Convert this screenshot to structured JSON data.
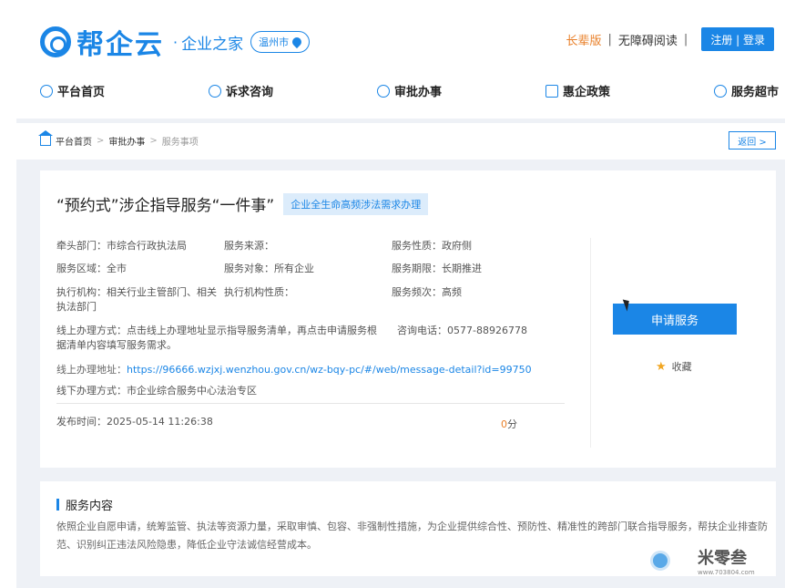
{
  "header": {
    "logo_text": "帮企云",
    "logo_sep": "·",
    "logo_sub": "企业之家",
    "city": "温州市",
    "elder_mode": "长辈版",
    "sep": "|",
    "accessibility": "无障碍阅读",
    "sep2": "|",
    "login": "注册 | 登录"
  },
  "nav": {
    "items": [
      {
        "label": "平台首页",
        "icon": "home-icon"
      },
      {
        "label": "诉求咨询",
        "icon": "chat-icon"
      },
      {
        "label": "审批办事",
        "icon": "person-icon"
      },
      {
        "label": "惠企政策",
        "icon": "document-icon"
      },
      {
        "label": "服务超市",
        "icon": "shop-icon"
      }
    ]
  },
  "breadcrumb": {
    "items": [
      "平台首页",
      "审批办事",
      "服务事项"
    ],
    "sep": ">",
    "back": "返回 >"
  },
  "detail": {
    "title": "“预约式”涉企指导服务“一件事”",
    "tag": "企业全生命高频涉法需求办理",
    "lead_dept": "牵头部门：市综合行政执法局",
    "service_source": "服务来源：",
    "service_nature": "服务性质：政府侧",
    "service_area": "服务区域：全市",
    "service_target": "服务对象：所有企业",
    "service_period": "服务期限：长期推进",
    "exec_agency": "执行机构：相关行业主管部门、相关执法部门",
    "exec_agency_nature": "执行机构性质：",
    "service_freq": "服务频次：高频",
    "online_method": "线上办理方式：点击线上办理地址显示指导服务清单，再点击申请服务根据清单内容填写服务需求。",
    "phone": "咨询电话：0577-88926778",
    "online_addr_label": "线上办理地址：",
    "online_addr_url": "https://96666.wzjxj.wenzhou.gov.cn/wz-bqy-pc/#/web/message-detail?id=99750",
    "offline_method": "线下办理方式：市企业综合服务中心法治专区",
    "publish_time": "发布时间：2025-05-14 11:26:38",
    "score_num": "0",
    "score_unit": "分",
    "apply_label": "申请服务",
    "favorite_label": "收藏"
  },
  "service_content": {
    "title": "服务内容",
    "body": "依照企业自愿申请，统筹监管、执法等资源力量，采取审慎、包容、非强制性措施，为企业提供综合性、预防性、精准性的跨部门联合指导服务，帮扶企业排查防范、识别纠正违法风险隐患，降低企业守法诚信经营成本。"
  },
  "watermark": {
    "name": "米零叁",
    "url": "www.703804.com"
  },
  "colors": {
    "accent": "#1b86e6",
    "orange": "#e9802a",
    "tag_bg": "#dcecfb",
    "page_bg": "#eef1f6"
  }
}
